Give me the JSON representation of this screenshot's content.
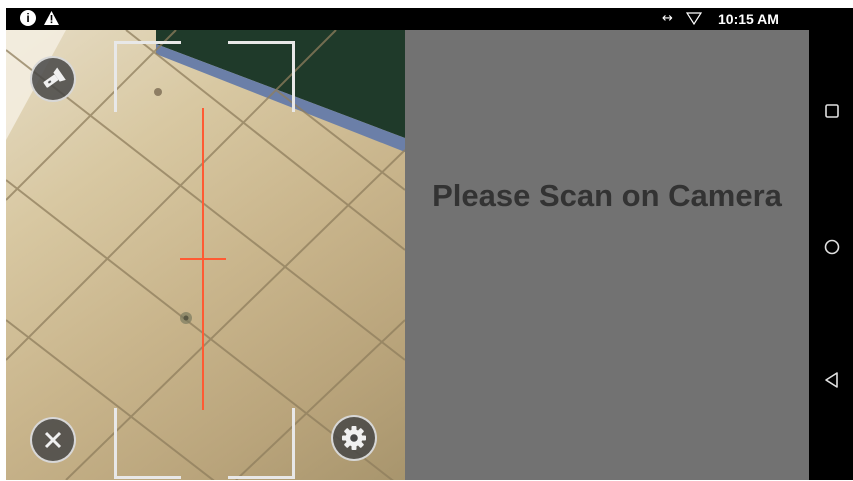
{
  "status_bar": {
    "info_icon": "info-icon",
    "warning_icon": "warning-icon",
    "network_icon": "data-transfer-icon",
    "network_glyph": "↔",
    "wifi_icon": "wifi-outline-icon",
    "time": "10:15 AM"
  },
  "camera": {
    "flash_button_icon": "flashlight-icon",
    "close_button_icon": "close-icon",
    "settings_button_icon": "gear-icon",
    "scan_line_color": "#ff5a33"
  },
  "panel": {
    "message": "Please Scan on Camera",
    "background": "#727272",
    "text_color": "#333333"
  },
  "nav_bar": {
    "recents_icon": "square-recents-icon",
    "home_icon": "circle-home-icon",
    "back_icon": "triangle-back-icon"
  }
}
